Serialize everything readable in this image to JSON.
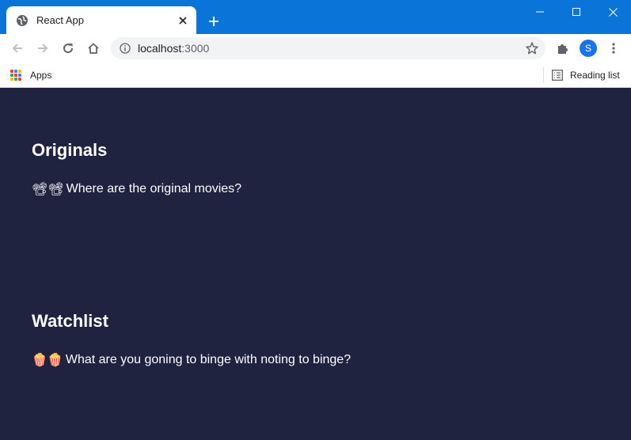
{
  "window": {
    "tab_title": "React App",
    "accent_color": "#0a74d9"
  },
  "toolbar": {
    "url_host": "localhost",
    "url_port": ":3000",
    "profile_initial": "S"
  },
  "bookmarks": {
    "apps_label": "Apps",
    "reading_list_label": "Reading list"
  },
  "page": {
    "background": "#1f2340",
    "sections": [
      {
        "title": "Originals",
        "emoji": "📽📽",
        "message": "Where are the original movies?"
      },
      {
        "title": "Watchlist",
        "emoji": "🍿🍿",
        "message": "What are you goning to binge with noting to binge?"
      }
    ]
  }
}
